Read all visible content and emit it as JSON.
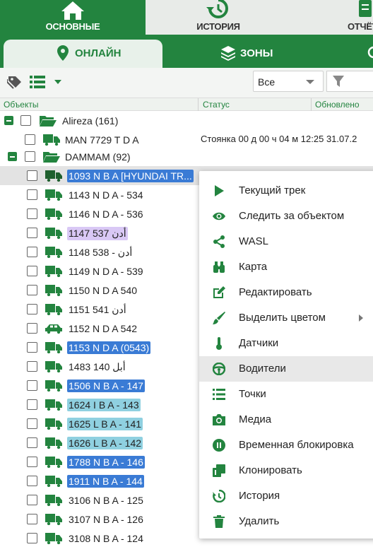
{
  "nav": {
    "tabs": [
      {
        "label": "ОСНОВНЫЕ",
        "icon": "home-icon"
      },
      {
        "label": "ИСТОРИЯ",
        "icon": "history-icon"
      },
      {
        "label": "ОТЧЁТЫ",
        "icon": "reports-icon"
      }
    ]
  },
  "subtabs": [
    {
      "label": "ОНЛАЙН",
      "icon": "location-pin-icon"
    },
    {
      "label": "ЗОНЫ",
      "icon": "layers-icon"
    }
  ],
  "toolbar": {
    "select_value": "Все"
  },
  "columns": {
    "objects": "Объекты",
    "status": "Статус",
    "updated": "Обновлено"
  },
  "groups": [
    {
      "name": "Alireza (161)"
    },
    {
      "name": "DAMMAM (92)"
    }
  ],
  "rows": [
    {
      "name": "MAN 7729 T D A",
      "status": "Стоянка 00 д 00 ч 04 м 12:25 31.07.2",
      "vehicle": "truck",
      "tag_color": ""
    },
    {
      "name": "1093 N B A [HYUNDAI TR...",
      "vehicle": "truck-dark",
      "tag_color": "#3a7bd5"
    },
    {
      "name": "1143 N D A - 534",
      "vehicle": "truck",
      "tag_color": ""
    },
    {
      "name": "1146 N D A - 536",
      "vehicle": "truck",
      "tag_color": ""
    },
    {
      "name": "1147 537 أدن",
      "vehicle": "truck",
      "tag_color": "#d9c8f5"
    },
    {
      "name": "1148 538 - أدن",
      "vehicle": "truck",
      "tag_color": ""
    },
    {
      "name": "1149 N D A - 539",
      "vehicle": "truck",
      "tag_color": ""
    },
    {
      "name": "1150 N D A 540",
      "vehicle": "truck",
      "tag_color": ""
    },
    {
      "name": "1151 541 أدن",
      "vehicle": "truck",
      "tag_color": ""
    },
    {
      "name": "1152 N D A 542",
      "vehicle": "car",
      "tag_color": ""
    },
    {
      "name": "1153 N D A (0543)",
      "vehicle": "truck",
      "tag_color": "#3a7bd5"
    },
    {
      "name": "1483 140 أبل",
      "vehicle": "truck",
      "tag_color": ""
    },
    {
      "name": "1506 N B A - 147",
      "vehicle": "truck",
      "tag_color": "#3a7bd5"
    },
    {
      "name": "1624 I B A - 143",
      "vehicle": "truck",
      "tag_color": "#8fd0e0"
    },
    {
      "name": "1625 L B A - 141",
      "vehicle": "truck",
      "tag_color": "#8fd0e0"
    },
    {
      "name": "1626 L B A - 142",
      "vehicle": "truck",
      "tag_color": "#8fd0e0"
    },
    {
      "name": "1788 N B A - 146",
      "vehicle": "truck",
      "tag_color": "#3a7bd5"
    },
    {
      "name": "1911 N B A - 144",
      "vehicle": "truck",
      "tag_color": "#3a7bd5"
    },
    {
      "name": "3106 N B A - 125",
      "vehicle": "truck",
      "tag_color": ""
    },
    {
      "name": "3107 N B A - 126",
      "vehicle": "truck",
      "tag_color": ""
    },
    {
      "name": "3108 N B A - 124",
      "vehicle": "truck",
      "tag_color": ""
    }
  ],
  "menu": [
    {
      "label": "Текущий трек",
      "icon": "play-icon"
    },
    {
      "label": "Следить за объектом",
      "icon": "eye-icon"
    },
    {
      "label": "WASL",
      "icon": "share-icon"
    },
    {
      "label": "Карта",
      "icon": "binoculars-icon"
    },
    {
      "label": "Редактировать",
      "icon": "edit-icon"
    },
    {
      "label": "Выделить цветом",
      "icon": "brush-icon"
    },
    {
      "label": "Датчики",
      "icon": "thermometer-icon"
    },
    {
      "label": "Водители",
      "icon": "steering-wheel-icon"
    },
    {
      "label": "Точки",
      "icon": "list-icon"
    },
    {
      "label": "Медиа",
      "icon": "camera-icon"
    },
    {
      "label": "Временная блокировка",
      "icon": "pause-icon"
    },
    {
      "label": "Клонировать",
      "icon": "clone-icon"
    },
    {
      "label": "История",
      "icon": "history-icon"
    },
    {
      "label": "Удалить",
      "icon": "trash-icon"
    }
  ],
  "colors": {
    "brand": "#23843f",
    "tag_blue": "#3a7bd5",
    "tag_lilac": "#d9c8f5",
    "tag_cyan": "#8fd0e0",
    "menu_hover": "#e8e8e8"
  }
}
